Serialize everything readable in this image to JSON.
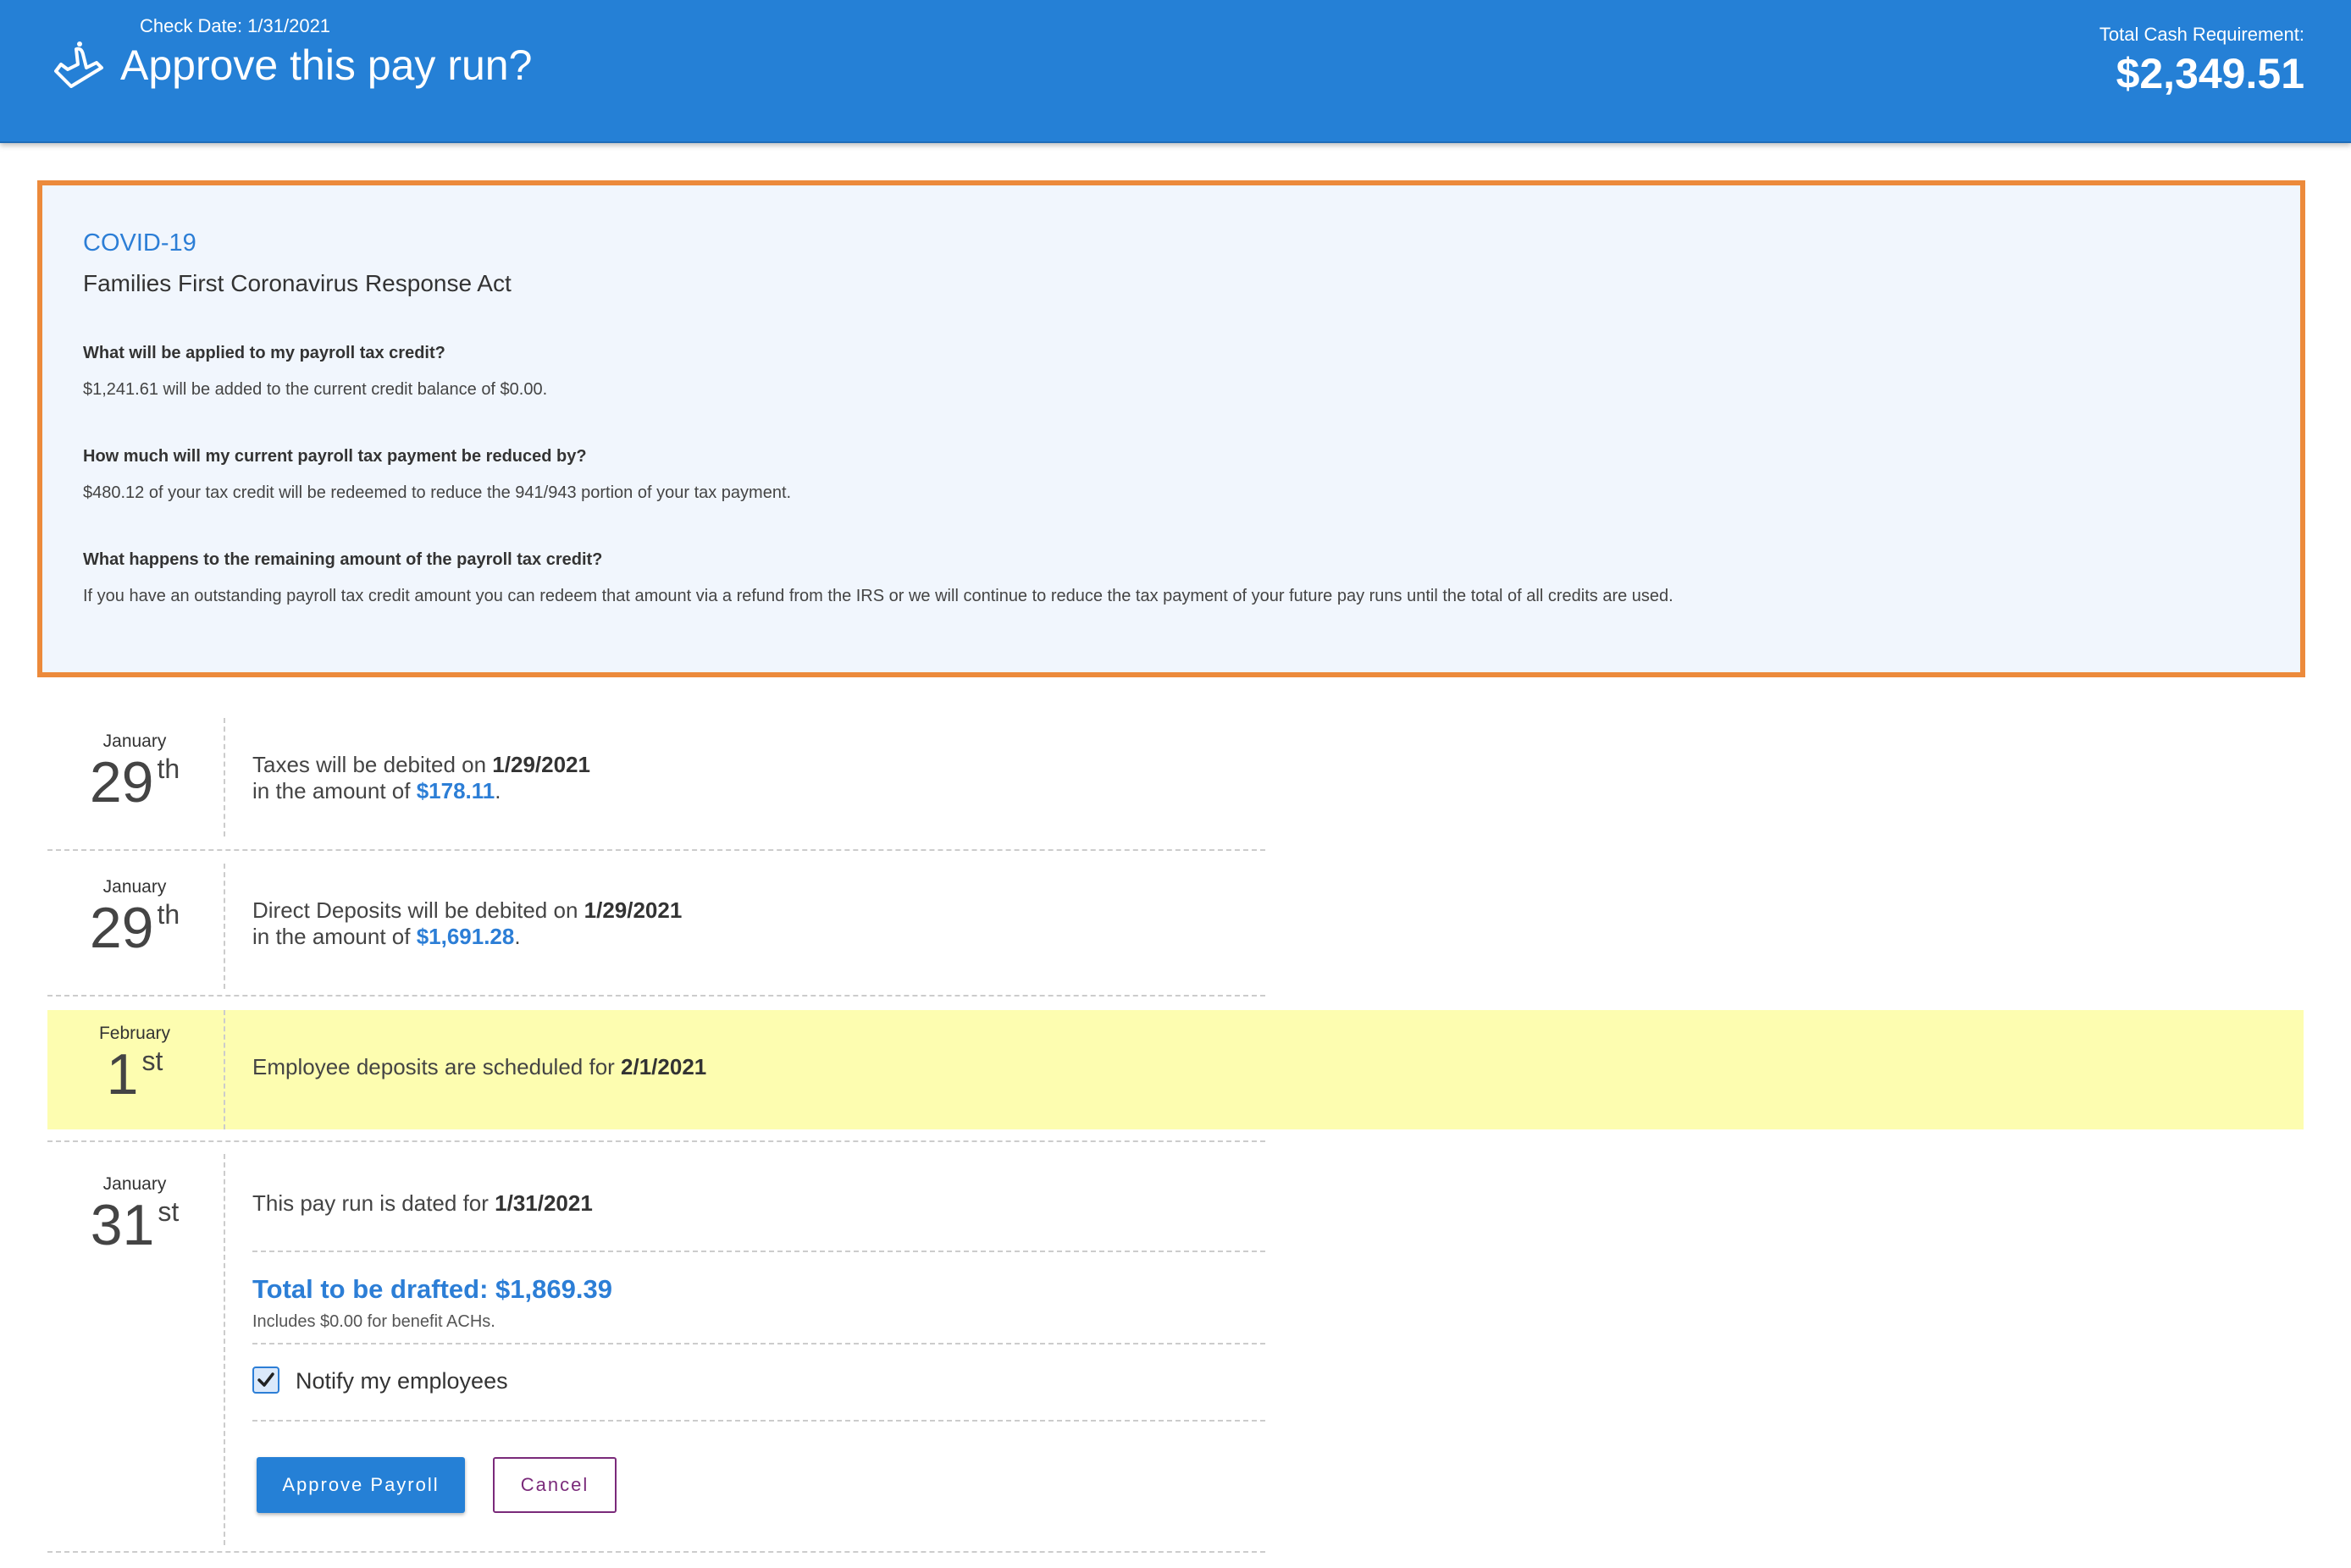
{
  "header": {
    "check_date": "Check Date: 1/31/2021",
    "title": "Approve this pay run?",
    "cash_label": "Total Cash Requirement:",
    "cash_value": "$2,349.51",
    "icon": "approve-hand-icon",
    "background": "#2580d6"
  },
  "covid": {
    "title": "COVID-19",
    "subtitle": "Families First Coronavirus Response Act",
    "border_color": "#ec8a3b",
    "qa": [
      {
        "q": "What will be applied to my payroll tax credit?",
        "a": "$1,241.61 will be added to the current credit balance of $0.00."
      },
      {
        "q": "How much will my current payroll tax payment be reduced by?",
        "a": "$480.12 of your tax credit will be redeemed to reduce the 941/943 portion of your tax payment."
      },
      {
        "q": "What happens to the remaining amount of the payroll tax credit?",
        "a": "If you have an outstanding payroll tax credit amount you can redeem that amount via a refund from the IRS or we will continue to reduce the tax payment of your future pay runs until the total of all credits are used."
      }
    ]
  },
  "timeline": [
    {
      "month": "January",
      "day": "29",
      "suffix": "th",
      "line1_pre": "Taxes will be debited on ",
      "line1_bold": "1/29/2021",
      "line2_pre": "in the amount of ",
      "amount": "$178.11",
      "line2_post": "."
    },
    {
      "month": "January",
      "day": "29",
      "suffix": "th",
      "line1_pre": "Direct Deposits will be debited on ",
      "line1_bold": "1/29/2021",
      "line2_pre": "in the amount of ",
      "amount": "$1,691.28",
      "line2_post": "."
    },
    {
      "month": "February",
      "day": "1",
      "suffix": "st",
      "line1_pre": "Employee deposits are scheduled for ",
      "line1_bold": "2/1/2021",
      "highlight_color": "#fdfdb0"
    },
    {
      "month": "January",
      "day": "31",
      "suffix": "st",
      "line1_pre": "This pay run is dated for ",
      "line1_bold": "1/31/2021"
    }
  ],
  "summary": {
    "total_label": "Total to be drafted: $1,869.39",
    "includes": "Includes $0.00 for benefit ACHs.",
    "notify_label": "Notify my employees",
    "notify_checked": true
  },
  "actions": {
    "approve_label": "Approve Payroll",
    "cancel_label": "Cancel"
  }
}
